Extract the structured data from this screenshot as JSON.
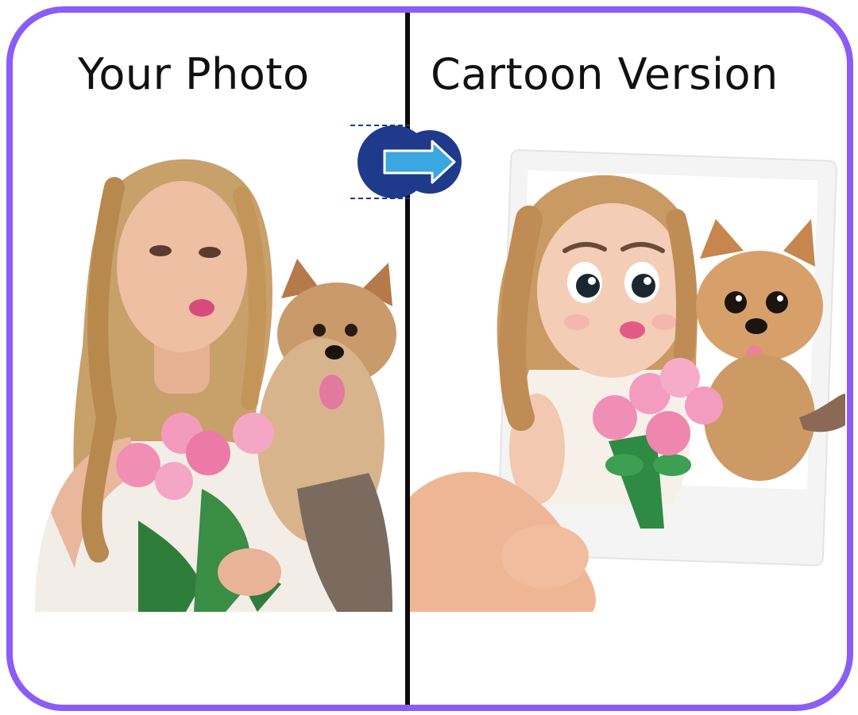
{
  "titles": {
    "left": "Your Photo",
    "right": "Cartoon Version"
  },
  "colors": {
    "frame": "#8b5cf6",
    "divider": "#0b0b0b",
    "arrow_circle": "#1f3a8a",
    "arrow_fill": "#3aa7e0"
  },
  "icons": {
    "arrow": "arrow-right-icon"
  }
}
